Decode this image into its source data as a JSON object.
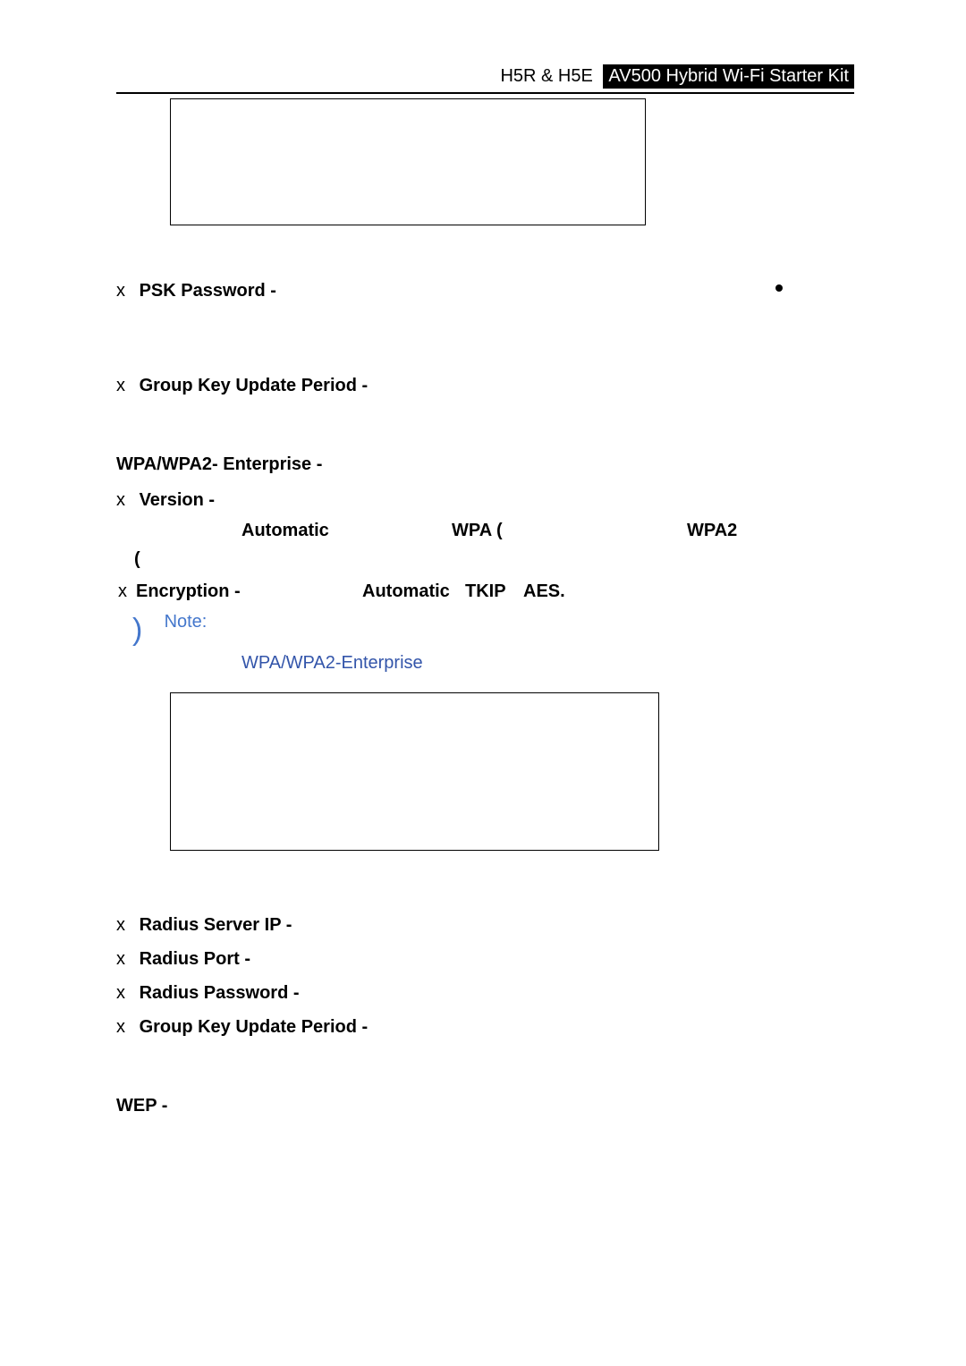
{
  "header": {
    "left": "H5R & H5E",
    "right": "AV500 Hybrid Wi-Fi Starter Kit"
  },
  "items": {
    "psk_password": "PSK  Password  -",
    "gkup": "Group Key Update Period  -",
    "wpa_ent": "WPA/WPA2- Enterprise -",
    "version": "Version   -",
    "automatic": "Automatic",
    "wpa_paren": "WPA (",
    "wpa2": "WPA2",
    "open_paren": "(",
    "encryption": "Encryption -",
    "tkip": "TKIP",
    "aes": "AES.",
    "note_label": "Note:",
    "note_link": "WPA/WPA2-Enterprise",
    "radius_ip": "Radius Server IP -",
    "radius_port": "Radius Port -",
    "radius_pw": "Radius Password -",
    "gkup2": "Group Key Update Period  -",
    "wep": "WEP -",
    "x": "x"
  }
}
